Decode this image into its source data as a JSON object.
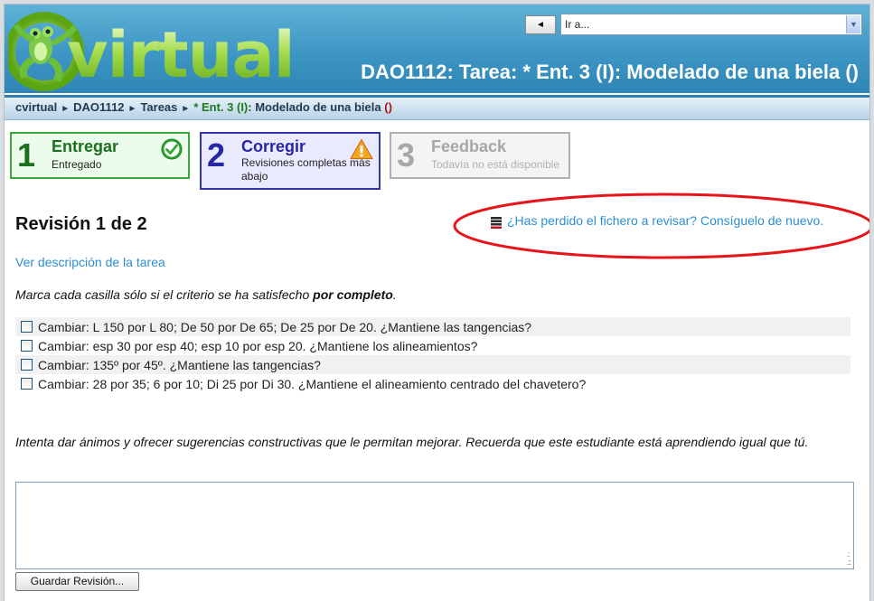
{
  "header": {
    "logo_text": "virtual",
    "nav_prev_symbol": "◄",
    "jump_select_value": "Ir a...",
    "page_title": "DAO1112: Tarea: * Ent. 3 (I): Modelado de una biela ()"
  },
  "breadcrumb": {
    "items": [
      "cvirtual",
      "DAO1112",
      "Tareas"
    ],
    "separator": "►",
    "current_main": "* Ent. 3 (I)",
    "current_rest": ": Modelado de una biela ",
    "current_paren": "()"
  },
  "steps": [
    {
      "number": "1",
      "title": "Entregar",
      "subtitle": "Entregado",
      "status": "done"
    },
    {
      "number": "2",
      "title": "Corregir",
      "subtitle": "Revisiones completas más abajo",
      "status": "warning"
    },
    {
      "number": "3",
      "title": "Feedback",
      "subtitle": "Todavía no está disponible",
      "status": "disabled"
    }
  ],
  "review": {
    "title": "Revisión 1 de 2",
    "lost_file_link": "¿Has perdido el fichero a revisar? Consíguelo de nuevo.",
    "task_description_link": "Ver descripción de la tarea",
    "instruction_prefix": "Marca cada casilla sólo si el criterio se ha satisfecho ",
    "instruction_bold": "por completo",
    "instruction_suffix": ".",
    "criteria": [
      "Cambiar: L 150 por L 80; De 50 por De 65; De 25 por De 20. ¿Mantiene las tangencias?",
      "Cambiar: esp 30 por esp 40; esp 10 por esp 20. ¿Mantiene los alineamientos?",
      "Cambiar: 135º por 45º. ¿Mantiene las tangencias?",
      "Cambiar: 28 por 35; 6 por 10; Di 25 por Di 30. ¿Mantiene el alineamiento centrado del chavetero?"
    ],
    "encouragement": "Intenta dar ánimos y ofrecer sugerencias constructivas que le permitan mejorar. Recuerda que este estudiante está aprendiendo igual que tú.",
    "feedback_value": "",
    "save_button": "Guardar Revisión..."
  },
  "colors": {
    "header_blue": "#3e96c4",
    "step_done": "#3da63d",
    "step_active": "#3434aa",
    "link": "#2b8fd1",
    "annotation_red": "#e8141b"
  }
}
